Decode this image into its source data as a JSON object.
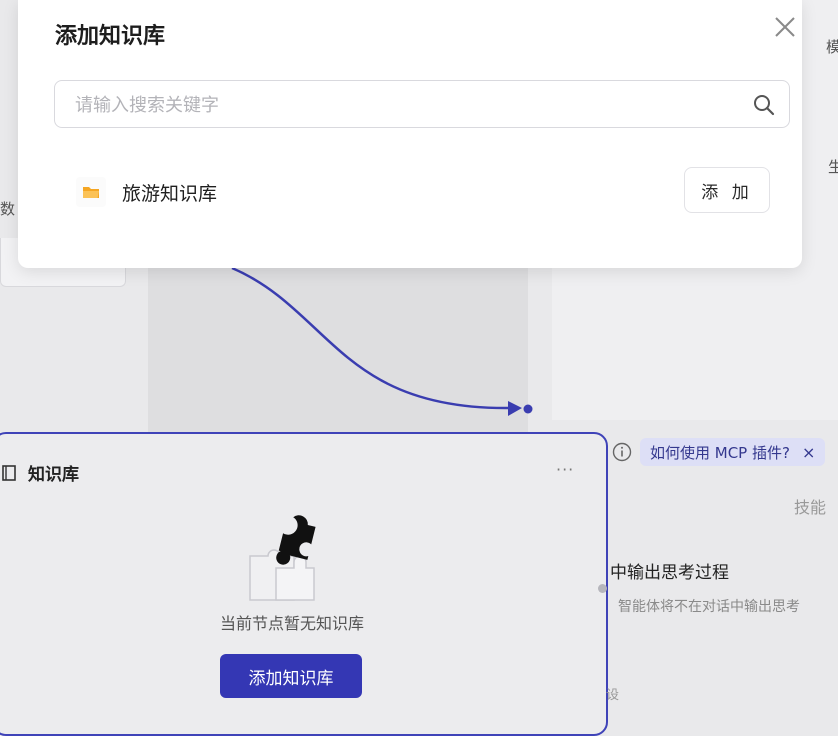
{
  "dialog": {
    "title": "添加知识库",
    "search_placeholder": "请输入搜索关键字",
    "items": [
      {
        "name": "旅游知识库",
        "add_label": "添 加"
      }
    ]
  },
  "node": {
    "title": "知识库",
    "more": "···",
    "empty_text": "当前节点暂无知识库",
    "add_button": "添加知识库"
  },
  "right_panel": {
    "mcp_hint": "如何使用 MCP 插件?",
    "mcp_close": "×",
    "skill_fragment": "技能",
    "think_title": "中输出思考过程",
    "think_desc": "智能体将不在对话中输出思考",
    "bottom_fragment": "设"
  },
  "edge_fragments": {
    "left_mid": "数",
    "right_top": "模",
    "right_mid": "生"
  },
  "colors": {
    "accent": "#3437b4",
    "node_border": "#3f43b8",
    "folder": "#f5a623",
    "mcp_pill_bg": "#dddff6"
  }
}
